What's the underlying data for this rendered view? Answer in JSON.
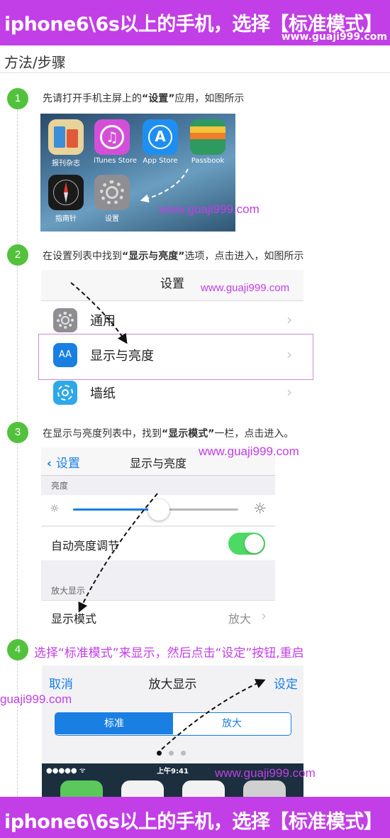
{
  "banner": {
    "title": "iphone6\\6s以上的手机，选择【标准模式】",
    "watermark": "www.guaji999.com"
  },
  "section_title": "方法/步骤",
  "watermark_text": "www.guaji999.com",
  "watermark_short": "guaji999.com",
  "steps": [
    {
      "num": "1",
      "pre": "先请打开手机主屏上的",
      "bold": "“设置”",
      "post": "应用，如图所示"
    },
    {
      "num": "2",
      "pre": "在设置列表中找到",
      "bold": "“显示与亮度”",
      "post": "选项，点击进入，如图所示"
    },
    {
      "num": "3",
      "pre": "在显示与亮度列表中，找到",
      "bold": "“显示模式”",
      "post": "一栏，点击进入。"
    },
    {
      "num": "4",
      "text": "选择“标准模式”来显示，然后点击“设定”按钮,重启"
    }
  ],
  "home_apps": [
    {
      "label": "报刊杂志",
      "icon": "newsstand-icon",
      "color": "#e8d39a"
    },
    {
      "label": "iTunes Store",
      "icon": "itunes-icon",
      "color": "#d34fd8"
    },
    {
      "label": "App Store",
      "icon": "app-store-icon",
      "color": "#1e8ff0"
    },
    {
      "label": "Passbook",
      "icon": "passbook-icon",
      "color": "#2f9a5f"
    },
    {
      "label": "指南针",
      "icon": "compass-icon",
      "color": "#1a1a1a"
    },
    {
      "label": "设置",
      "icon": "settings-icon",
      "color": "#8e8e93"
    }
  ],
  "settings_list": {
    "header": "设置",
    "rows": [
      {
        "label": "通用",
        "icon": "gear-icon",
        "color": "#8e8e93"
      },
      {
        "label": "显示与亮度",
        "icon": "text-size-icon",
        "color": "#1a7fe3"
      },
      {
        "label": "墙纸",
        "icon": "flower-icon",
        "color": "#2ea8e8"
      }
    ]
  },
  "display_screen": {
    "back": "设置",
    "title": "显示与亮度",
    "brightness_header": "亮度",
    "brightness_level": 0.52,
    "auto_brightness": "自动亮度调节",
    "auto_brightness_on": true,
    "zoom_header": "放大显示",
    "display_mode": "显示模式",
    "display_mode_value": "放大"
  },
  "zoom_screen": {
    "cancel": "取消",
    "title": "放大显示",
    "set": "设定",
    "seg_standard": "标准",
    "seg_zoomed": "放大",
    "time": "上午9:41"
  },
  "colors": {
    "accent": "#c23ee6",
    "ios_blue": "#1a7fe3",
    "step_green": "#52c23c"
  }
}
